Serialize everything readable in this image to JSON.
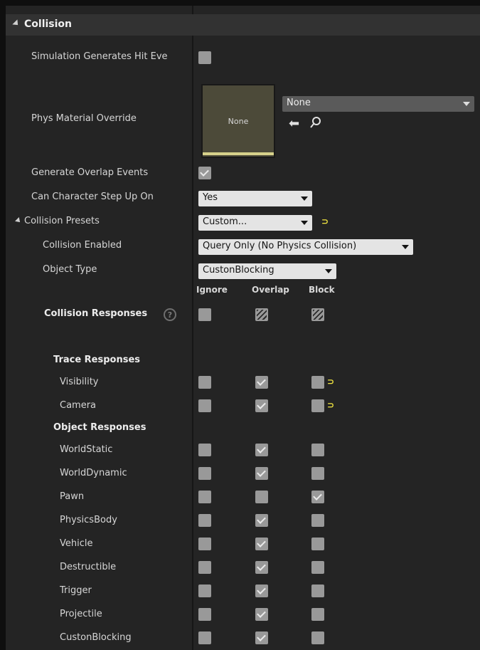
{
  "section": {
    "title": "Collision"
  },
  "rows": {
    "sim_hit": {
      "label": "Simulation Generates Hit Eve"
    },
    "phys_material": {
      "label": "Phys Material Override",
      "thumbnail_text": "None",
      "selected": "None",
      "browse_icon": "arrow-left-icon",
      "search_icon": "search-icon"
    },
    "overlap_events": {
      "label": "Generate Overlap Events"
    },
    "step_up": {
      "label": "Can Character Step Up On",
      "value": "Yes"
    },
    "presets": {
      "label": "Collision Presets",
      "value": "Custom...",
      "reset_icon": "⊃"
    },
    "enabled": {
      "label": "Collision Enabled",
      "value": "Query Only (No Physics Collision)"
    },
    "object_type": {
      "label": "Object Type",
      "value": "CustonBlocking"
    }
  },
  "responses": {
    "columns": [
      "Ignore",
      "Overlap",
      "Block"
    ],
    "header_label": "Collision Responses",
    "help_icon": "?",
    "trace_heading": "Trace Responses",
    "object_heading": "Object Responses",
    "reset_glyph": "⊃",
    "trace": [
      {
        "name": "Visibility",
        "state": "overlap",
        "modified": true
      },
      {
        "name": "Camera",
        "state": "overlap",
        "modified": true
      }
    ],
    "object": [
      {
        "name": "WorldStatic",
        "state": "overlap"
      },
      {
        "name": "WorldDynamic",
        "state": "overlap"
      },
      {
        "name": "Pawn",
        "state": "block"
      },
      {
        "name": "PhysicsBody",
        "state": "overlap"
      },
      {
        "name": "Vehicle",
        "state": "overlap"
      },
      {
        "name": "Destructible",
        "state": "overlap"
      },
      {
        "name": "Trigger",
        "state": "overlap"
      },
      {
        "name": "Projectile",
        "state": "overlap"
      },
      {
        "name": "CustonBlocking",
        "state": "overlap"
      }
    ]
  }
}
